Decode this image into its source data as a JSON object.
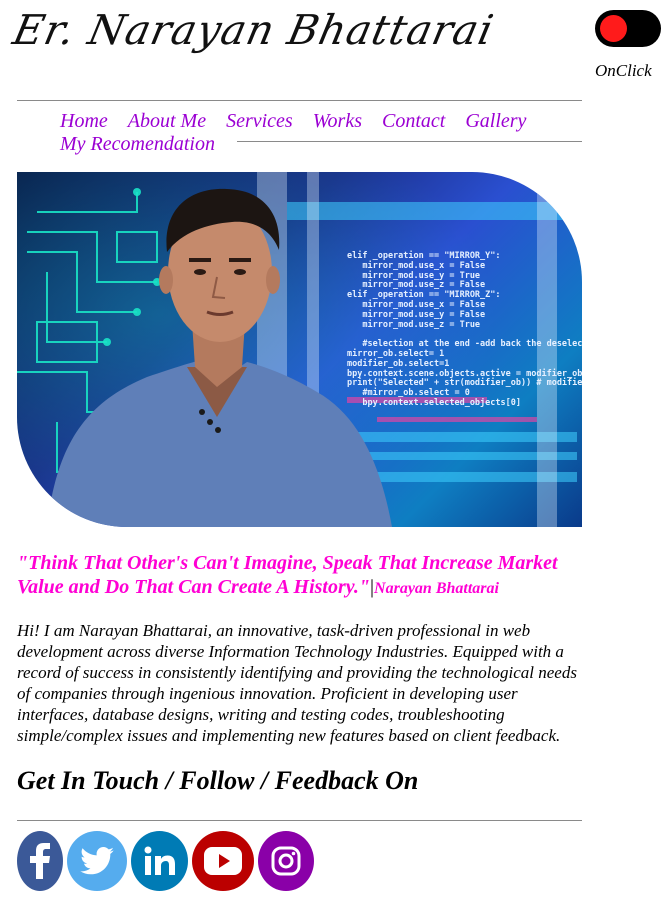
{
  "header": {
    "title": "Er. Narayan Bhattarai",
    "toggle_label": "OnClick"
  },
  "nav": {
    "items": [
      "Home",
      "About Me",
      "Services",
      "Works",
      "Contact",
      "Gallery",
      "My Recomendation"
    ]
  },
  "hero": {
    "code_text": "elif _operation == \"MIRROR_Y\":\n   mirror_mod.use_x = False\n   mirror_mod.use_y = True\n   mirror_mod.use_z = False\nelif _operation == \"MIRROR_Z\":\n   mirror_mod.use_x = False\n   mirror_mod.use_y = False\n   mirror_mod.use_z = True\n\n   #selection at the end -add back the deselected\nmirror_ob.select= 1\nmodifier_ob.select=1\nbpy.context.scene.objects.active = modifier_ob\nprint(\"Selected\" + str(modifier_ob)) # modifier ob\n   #mirror_ob.select = 0\n   bpy.context.selected_objects[0]"
  },
  "quote": {
    "text": "\"Think That Other's Can't Imagine, Speak That Increase Market Value and Do That Can Create A History.\"",
    "separator": "|",
    "author": "Narayan Bhattarai"
  },
  "about": {
    "text": "Hi! I am Narayan Bhattarai, an innovative, task-driven professional in web development across diverse Information Technology Industries. Equipped with a record of success in consistently identifying and providing the technological needs of companies through ingenious innovation. Proficient in developing user interfaces, database designs, writing and testing codes, troubleshooting simple/complex issues and implementing new features based on client feedback."
  },
  "social": {
    "heading": "Get In Touch / Follow / Feedback On",
    "items": [
      {
        "name": "facebook",
        "icon": "facebook-icon",
        "color": "#3b5998"
      },
      {
        "name": "twitter",
        "icon": "twitter-icon",
        "color": "#55acee"
      },
      {
        "name": "linkedin",
        "icon": "linkedin-icon",
        "color": "#007bb5"
      },
      {
        "name": "youtube",
        "icon": "youtube-icon",
        "color": "#bb0000"
      },
      {
        "name": "instagram",
        "icon": "instagram-icon",
        "color": "#8a00a8"
      }
    ]
  },
  "colors": {
    "nav": "#9b00d3",
    "quote": "#ff00d4",
    "toggle_knob": "#ff1b1b"
  }
}
